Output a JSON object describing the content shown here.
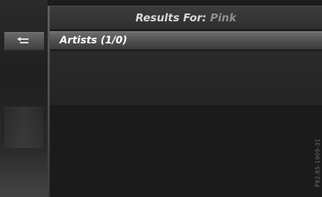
{
  "header": {
    "title_prefix": "Results For:",
    "query": "Pink"
  },
  "results": {
    "selected_item": "Artists (1/0)"
  },
  "nav": {
    "back_icon": "back-arrow-icon"
  },
  "footer": {
    "ref_code": "P82.85-1909-31"
  },
  "colors": {
    "selected_row": "#5a5a5a",
    "header_text": "#d8d8d8",
    "query_text": "#8f8f8f"
  }
}
